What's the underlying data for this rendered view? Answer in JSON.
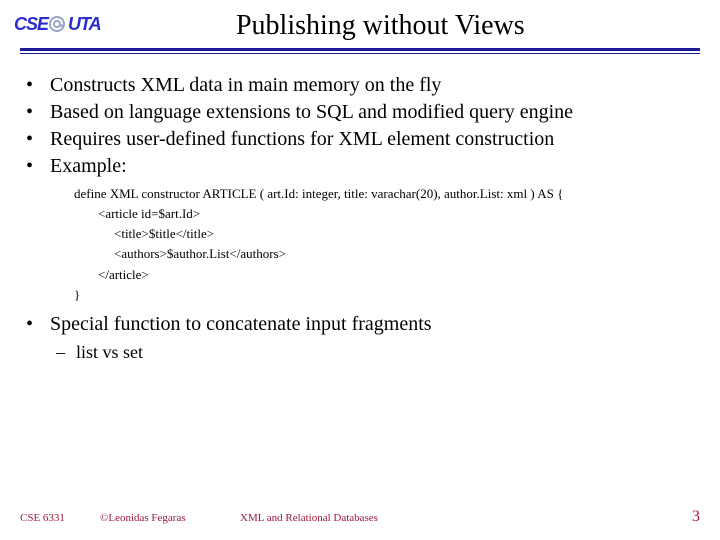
{
  "header": {
    "logo_cse": "CSE",
    "logo_uta": "UTA",
    "title": "Publishing without Views"
  },
  "bullets": {
    "b0": "Constructs XML data in main memory on the fly",
    "b1": "Based on language extensions to SQL and modified query engine",
    "b2": "Requires user-defined functions for XML element construction",
    "b3": "Example:",
    "b4": "Special function to concatenate input fragments"
  },
  "code": {
    "l0": "define XML constructor ARTICLE ( art.Id: integer, title: varachar(20), author.List: xml ) AS {",
    "l1": "<article id=$art.Id>",
    "l2": "<title>$title</title>",
    "l3": "<authors>$author.List</authors>",
    "l4": "</article>",
    "l5": "}"
  },
  "sub": {
    "s0": "list vs set"
  },
  "footer": {
    "course": "CSE 6331",
    "copyright": "©Leonidas Fegaras",
    "topic": "XML and Relational Databases",
    "page": "3"
  }
}
